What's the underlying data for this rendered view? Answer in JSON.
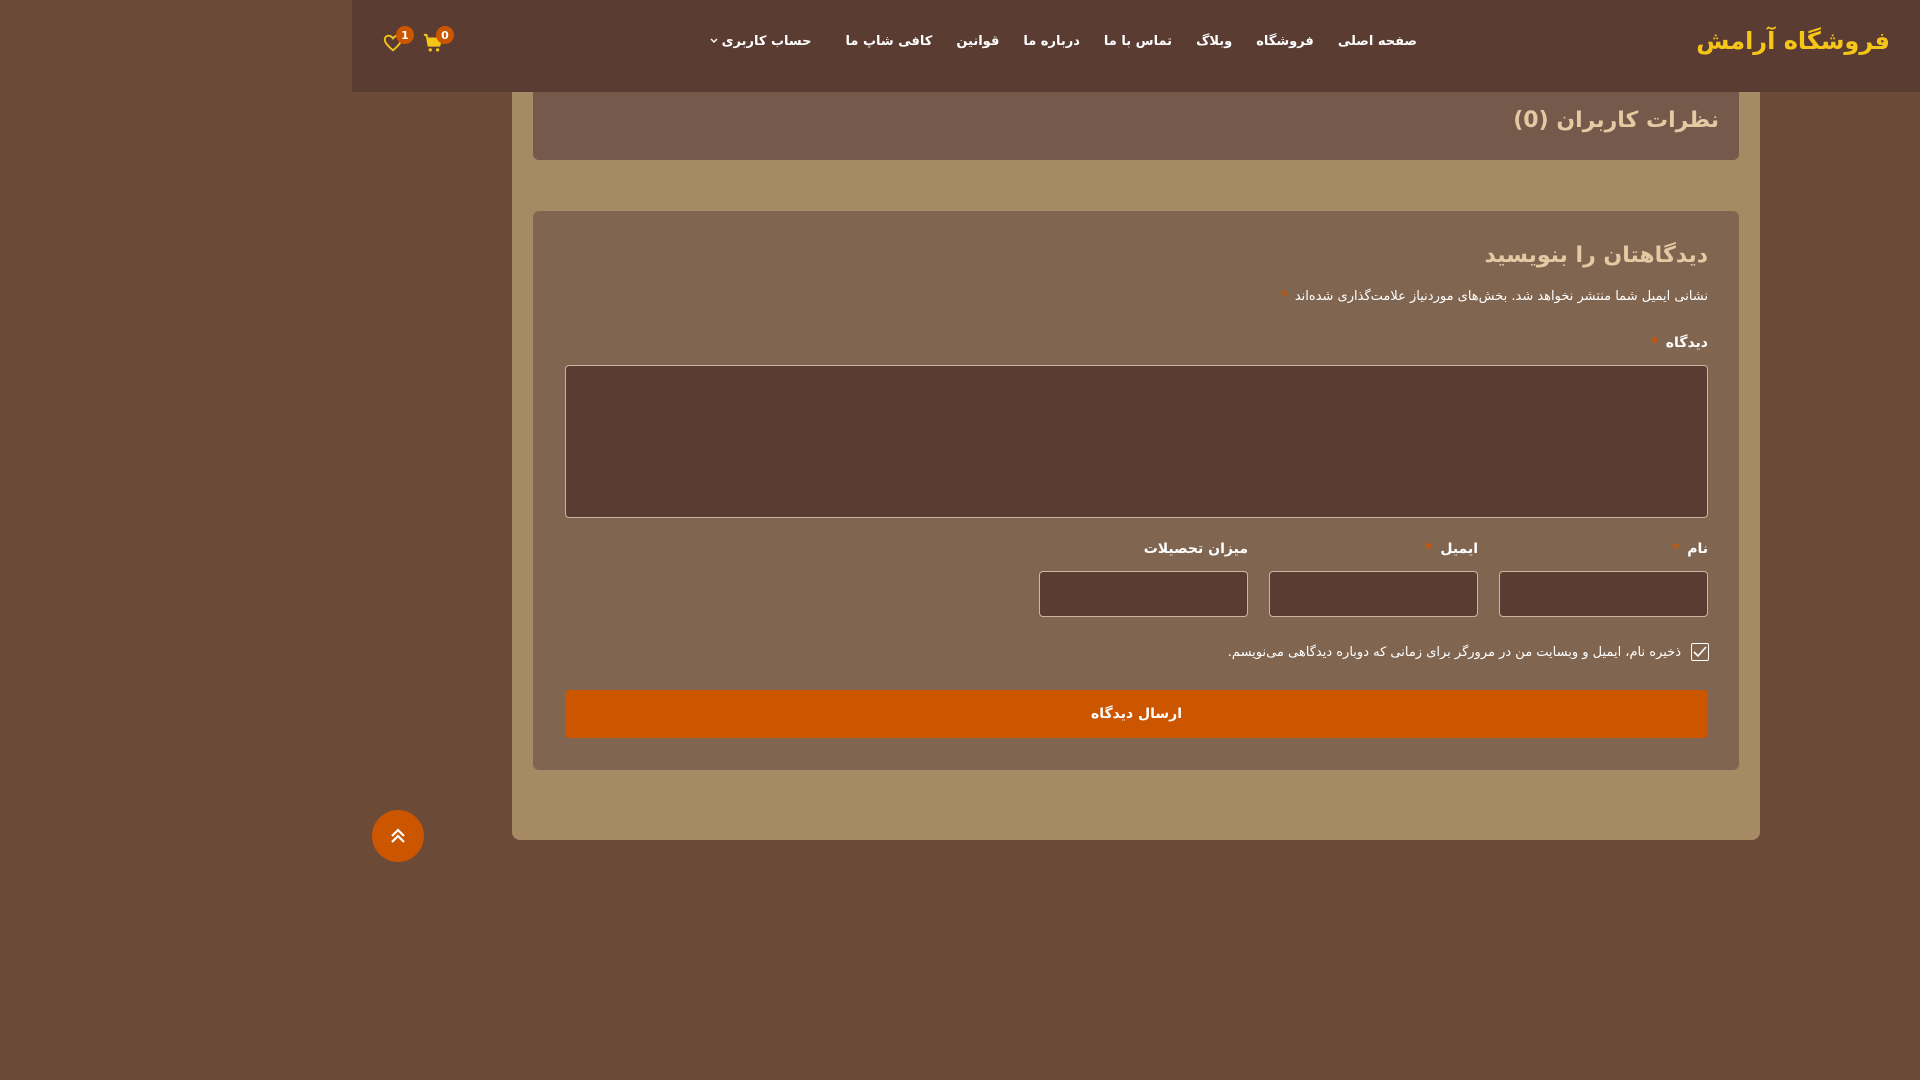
{
  "header": {
    "brand": "فروشگاه آرامش",
    "nav": [
      "صفحه اصلی",
      "فروشگاه",
      "وبلاگ",
      "تماس با ما",
      "درباره ما",
      "قوانین",
      "کافی شاپ ما"
    ],
    "account_label": "حساب کاربری",
    "cart_count": "0",
    "wishlist_count": "1"
  },
  "reviews": {
    "title": "نظرات کاربران (0)"
  },
  "form": {
    "title": "دیدگاهتان را بنویسید",
    "notice": "نشانی ایمیل شما منتشر نخواهد شد. بخش‌های موردنیاز علامت‌گذاری شده‌اند",
    "required_mark": "*",
    "comment_label": "دیدگاه",
    "name_label": "نام",
    "email_label": "ایمیل",
    "education_label": "میزان تحصیلات",
    "save_info_label": "ذخیره نام، ایمیل و وبسایت من در مرورگر برای زمانی که دوباره دیدگاهی می‌نویسم.",
    "save_info_checked": true,
    "submit_label": "ارسال دیدگاه"
  },
  "colors": {
    "header_bg": "#5a3c33",
    "page_bg": "#6b4b37",
    "content_bg": "#a68a64",
    "brand": "#f5c518",
    "accent": "#cc5500",
    "title": "#e6c9a3"
  },
  "icons": {
    "wishlist": "heart-icon",
    "cart": "cart-icon",
    "account_chevron": "chevron-down-icon",
    "scroll_top": "double-chevron-up-icon",
    "checkbox": "check-icon"
  }
}
